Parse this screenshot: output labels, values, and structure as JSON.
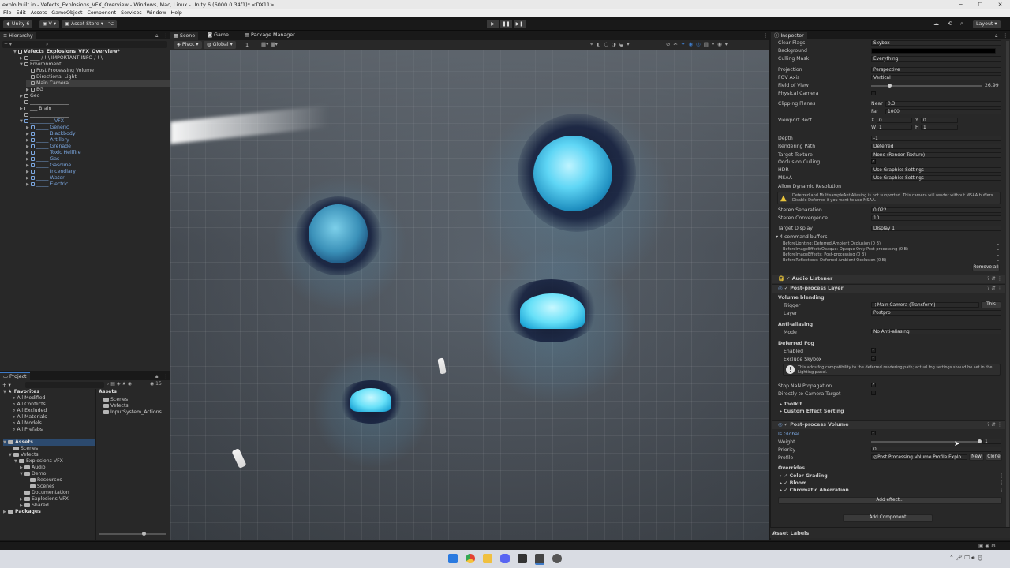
{
  "window": {
    "title": "explo built in - Vefects_Explosions_VFX_Overview - Windows, Mac, Linux - Unity 6 (6000.0.34f1)* <DX11>"
  },
  "menu": [
    "File",
    "Edit",
    "Assets",
    "GameObject",
    "Component",
    "Services",
    "Window",
    "Help"
  ],
  "toolbar": {
    "unity_label": "Unity 6",
    "account": "V",
    "asset_store": "Asset Store",
    "layout": "Layout"
  },
  "hierarchy": {
    "tab": "Hierarchy",
    "scene": "Vefects_Explosions_VFX_Overview*",
    "items": [
      {
        "label": "____ / ! \\ IMPORTANT INFO / ! \\",
        "indent": 1,
        "type": "cube",
        "arrow": ">",
        "blue": false
      },
      {
        "label": "Environment",
        "indent": 1,
        "type": "cube",
        "arrow": "v",
        "blue": false
      },
      {
        "label": "Post Processing Volume",
        "indent": 2,
        "type": "cube",
        "arrow": "",
        "blue": false
      },
      {
        "label": "Directional Light",
        "indent": 2,
        "type": "cube",
        "arrow": "",
        "blue": false
      },
      {
        "label": "Main Camera",
        "indent": 2,
        "type": "cube",
        "arrow": "",
        "blue": false,
        "selected": true
      },
      {
        "label": "BG",
        "indent": 2,
        "type": "cube",
        "arrow": ">",
        "blue": false
      },
      {
        "label": "Geo",
        "indent": 1,
        "type": "cube",
        "arrow": ">",
        "blue": false
      },
      {
        "label": "________________",
        "indent": 1,
        "type": "cube",
        "arrow": "",
        "blue": false
      },
      {
        "label": "___ Brain",
        "indent": 1,
        "type": "cube",
        "arrow": ">",
        "blue": false
      },
      {
        "label": "________________",
        "indent": 1,
        "type": "cube",
        "arrow": "",
        "blue": false
      },
      {
        "label": "__________VFX",
        "indent": 1,
        "type": "prefab",
        "arrow": "v",
        "blue": true
      },
      {
        "label": "_____ Generic",
        "indent": 2,
        "type": "prefab",
        "arrow": ">",
        "blue": true
      },
      {
        "label": "_____ Blackbody",
        "indent": 2,
        "type": "prefab",
        "arrow": ">",
        "blue": true
      },
      {
        "label": "_____ Artillery",
        "indent": 2,
        "type": "prefab",
        "arrow": ">",
        "blue": true
      },
      {
        "label": "_____ Grenade",
        "indent": 2,
        "type": "prefab",
        "arrow": ">",
        "blue": true
      },
      {
        "label": "_____ Toxic Hellfire",
        "indent": 2,
        "type": "prefab",
        "arrow": ">",
        "blue": true
      },
      {
        "label": "_____ Gas",
        "indent": 2,
        "type": "prefab",
        "arrow": ">",
        "blue": true
      },
      {
        "label": "_____ Gasoline",
        "indent": 2,
        "type": "prefab",
        "arrow": ">",
        "blue": true
      },
      {
        "label": "_____ Incendiary",
        "indent": 2,
        "type": "prefab",
        "arrow": ">",
        "blue": true
      },
      {
        "label": "_____ Water",
        "indent": 2,
        "type": "prefab",
        "arrow": ">",
        "blue": true
      },
      {
        "label": "_____ Electric",
        "indent": 2,
        "type": "prefab",
        "arrow": ">",
        "blue": true
      }
    ]
  },
  "scene_view": {
    "tabs": [
      "Scene",
      "Game",
      "Package Manager"
    ],
    "pivot": "Pivot",
    "global": "Global",
    "grid_value": "1"
  },
  "project": {
    "tab": "Project",
    "count": "15",
    "favorites_label": "Favorites",
    "favorites": [
      "All Modified",
      "All Conflicts",
      "All Excluded",
      "All Materials",
      "All Models",
      "All Prefabs"
    ],
    "tree": [
      {
        "label": "Assets",
        "indent": 0,
        "arrow": "v",
        "bold": true
      },
      {
        "label": "Scenes",
        "indent": 1,
        "arrow": ""
      },
      {
        "label": "Vefects",
        "indent": 1,
        "arrow": "v"
      },
      {
        "label": "Explosions VFX",
        "indent": 2,
        "arrow": "v"
      },
      {
        "label": "Audio",
        "indent": 3,
        "arrow": ">"
      },
      {
        "label": "Demo",
        "indent": 3,
        "arrow": "v"
      },
      {
        "label": "Resources",
        "indent": 4,
        "arrow": ""
      },
      {
        "label": "Scenes",
        "indent": 4,
        "arrow": ""
      },
      {
        "label": "Documentation",
        "indent": 3,
        "arrow": ""
      },
      {
        "label": "Explosions VFX",
        "indent": 3,
        "arrow": ">"
      },
      {
        "label": "Shared",
        "indent": 3,
        "arrow": ">"
      },
      {
        "label": "Packages",
        "indent": 0,
        "arrow": ">",
        "bold": true
      }
    ],
    "assets_header": "Assets",
    "assets": [
      "Scenes",
      "Vefects",
      "InputSystem_Actions"
    ]
  },
  "inspector": {
    "tab": "Inspector",
    "camera_fields": [
      {
        "label": "Clear Flags",
        "value": "Skybox"
      },
      {
        "label": "Background",
        "value": ""
      },
      {
        "label": "Culling Mask",
        "value": "Everything"
      },
      {
        "label": "Projection",
        "value": "Perspective"
      },
      {
        "label": "FOV Axis",
        "value": "Vertical"
      },
      {
        "label": "Field of View",
        "value": "26.99"
      },
      {
        "label": "Physical Camera",
        "value": ""
      },
      {
        "label": "Clipping Planes",
        "value": ""
      },
      {
        "label": "Viewport Rect",
        "value": ""
      },
      {
        "label": "Depth",
        "value": "-1"
      },
      {
        "label": "Rendering Path",
        "value": "Deferred"
      },
      {
        "label": "Target Texture",
        "value": "None (Render Texture)"
      },
      {
        "label": "Occlusion Culling",
        "value": "✓"
      },
      {
        "label": "HDR",
        "value": "Use Graphics Settings"
      },
      {
        "label": "MSAA",
        "value": "Use Graphics Settings"
      },
      {
        "label": "Allow Dynamic Resolution",
        "value": ""
      }
    ],
    "clip": {
      "near_label": "Near",
      "near": "0.3",
      "far_label": "Far",
      "far": "1000"
    },
    "viewport": {
      "x": "0",
      "y": "0",
      "w": "1",
      "h": "1"
    },
    "warning": "Deferred and MultisampleAntiAliasing is not supported. This camera will render without MSAA buffers. Disable Deferred if you want to use MSAA.",
    "stereo": [
      {
        "label": "Stereo Separation",
        "value": "0.022"
      },
      {
        "label": "Stereo Convergence",
        "value": "10"
      },
      {
        "label": "Target Display",
        "value": "Display 1"
      }
    ],
    "command_buffers_title": "4 command buffers",
    "command_buffers": [
      "BeforeLighting: Deferred Ambient Occlusion (0 B)",
      "BeforeImageEffectsOpaque: Opaque Only Post-processing (0 B)",
      "BeforeImageEffects: Post-processing (0 B)",
      "BeforeReflections: Deferred Ambient Occlusion (0 B)"
    ],
    "remove_all": "Remove all",
    "audio_listener": "Audio Listener",
    "pp_layer": {
      "title": "Post-process Layer",
      "volume_blending": "Volume blending",
      "trigger_label": "Trigger",
      "trigger": "Main Camera (Transform)",
      "this": "This",
      "layer_label": "Layer",
      "layer": "Postpro",
      "aa": "Anti-aliasing",
      "mode_label": "Mode",
      "mode": "No Anti-aliasing",
      "fog": "Deferred Fog",
      "enabled": "Enabled",
      "exclude_skybox": "Exclude Skybox",
      "fog_info": "This adds fog compatibility to the deferred rendering path; actual fog settings should be set in the Lighting panel.",
      "stop_nan": "Stop NaN Propagation",
      "direct_cam": "Directly to Camera Target",
      "toolkit": "Toolkit",
      "custom_sort": "Custom Effect Sorting"
    },
    "pp_volume": {
      "title": "Post-process Volume",
      "is_global": "Is Global",
      "weight_label": "Weight",
      "weight": "1",
      "priority_label": "Priority",
      "priority": "0",
      "profile_label": "Profile",
      "profile": "Post Processing Volume Profile Explo",
      "new": "New",
      "clone": "Clone",
      "overrides": "Overrides",
      "effects": [
        "Color Grading",
        "Bloom",
        "Chromatic Aberration"
      ],
      "add_effect": "Add effect..."
    },
    "add_component": "Add Component",
    "asset_labels": "Asset Labels"
  },
  "colors": {
    "accent": "#3d7ac8",
    "prefab_blue": "#7ba7e0",
    "vfx_cyan": "#5fd6f5"
  }
}
